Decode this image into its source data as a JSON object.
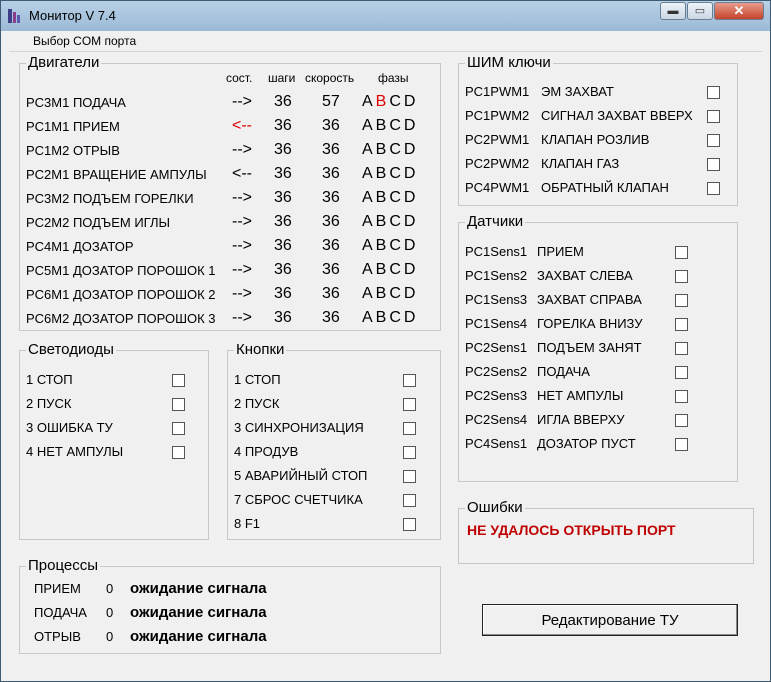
{
  "window": {
    "title": "Монитор  V 7.4",
    "min_glyph": "▬",
    "max_glyph": "▭",
    "close_glyph": "✕"
  },
  "menu": {
    "com_port": "Выбор COM порта"
  },
  "colors": {
    "error_red": "#c00000",
    "arrow_red": "#e00000"
  },
  "motors": {
    "title": "Двигатели",
    "headers": {
      "state": "сост.",
      "steps": "шаги",
      "speed": "скорость",
      "phases": "фазы"
    },
    "rows": [
      {
        "name": "PC3M1 ПОДАЧА",
        "arrow": "-->",
        "steps": "36",
        "speed": "57",
        "phases": [
          "A",
          "B",
          "C",
          "D"
        ],
        "red_phase": 1,
        "red_arrow": false
      },
      {
        "name": "PC1M1 ПРИЕМ",
        "arrow": "<--",
        "steps": "36",
        "speed": "36",
        "phases": [
          "A",
          "B",
          "C",
          "D"
        ],
        "red_phase": -1,
        "red_arrow": true
      },
      {
        "name": "PC1M2 ОТРЫВ",
        "arrow": "-->",
        "steps": "36",
        "speed": "36",
        "phases": [
          "A",
          "B",
          "C",
          "D"
        ],
        "red_phase": -1,
        "red_arrow": false
      },
      {
        "name": "PC2M1 ВРАЩЕНИЕ АМПУЛЫ",
        "arrow": "<--",
        "steps": "36",
        "speed": "36",
        "phases": [
          "A",
          "B",
          "C",
          "D"
        ],
        "red_phase": -1,
        "red_arrow": false
      },
      {
        "name": "PC3M2 ПОДЪЕМ ГОРЕЛКИ",
        "arrow": "-->",
        "steps": "36",
        "speed": "36",
        "phases": [
          "A",
          "B",
          "C",
          "D"
        ],
        "red_phase": -1,
        "red_arrow": false
      },
      {
        "name": "PC2M2 ПОДЪЕМ ИГЛЫ",
        "arrow": "-->",
        "steps": "36",
        "speed": "36",
        "phases": [
          "A",
          "B",
          "C",
          "D"
        ],
        "red_phase": -1,
        "red_arrow": false
      },
      {
        "name": "PC4M1 ДОЗАТОР",
        "arrow": "-->",
        "steps": "36",
        "speed": "36",
        "phases": [
          "A",
          "B",
          "C",
          "D"
        ],
        "red_phase": -1,
        "red_arrow": false
      },
      {
        "name": "PC5M1 ДОЗАТОР ПОРОШОК 1",
        "arrow": "-->",
        "steps": "36",
        "speed": "36",
        "phases": [
          "A",
          "B",
          "C",
          "D"
        ],
        "red_phase": -1,
        "red_arrow": false
      },
      {
        "name": "PC6M1 ДОЗАТОР ПОРОШОК 2",
        "arrow": "-->",
        "steps": "36",
        "speed": "36",
        "phases": [
          "A",
          "B",
          "C",
          "D"
        ],
        "red_phase": -1,
        "red_arrow": false
      },
      {
        "name": "PC6M2 ДОЗАТОР ПОРОШОК 3",
        "arrow": "-->",
        "steps": "36",
        "speed": "36",
        "phases": [
          "A",
          "B",
          "C",
          "D"
        ],
        "red_phase": -1,
        "red_arrow": false
      }
    ]
  },
  "pwm": {
    "title": "ШИМ ключи",
    "rows": [
      {
        "code": "PC1PWM1",
        "name": "ЭМ ЗАХВАТ"
      },
      {
        "code": "PC1PWM2",
        "name": "СИГНАЛ ЗАХВАТ ВВЕРХ"
      },
      {
        "code": "PC2PWM1",
        "name": "КЛАПАН РОЗЛИВ"
      },
      {
        "code": "PC2PWM2",
        "name": "КЛАПАН ГАЗ"
      },
      {
        "code": "PC4PWM1",
        "name": "ОБРАТНЫЙ КЛАПАН"
      }
    ]
  },
  "sensors": {
    "title": "Датчики",
    "rows": [
      {
        "code": "PC1Sens1",
        "name": "ПРИЕМ"
      },
      {
        "code": "PC1Sens2",
        "name": "ЗАХВАТ СЛЕВА"
      },
      {
        "code": "PC1Sens3",
        "name": "ЗАХВАТ СПРАВА"
      },
      {
        "code": "PC1Sens4",
        "name": "ГОРЕЛКА ВНИЗУ"
      },
      {
        "code": "PC2Sens1",
        "name": "ПОДЪЕМ ЗАНЯТ"
      },
      {
        "code": "PC2Sens2",
        "name": "ПОДАЧА"
      },
      {
        "code": "PC2Sens3",
        "name": "НЕТ АМПУЛЫ"
      },
      {
        "code": "PC2Sens4",
        "name": "ИГЛА ВВЕРХУ"
      },
      {
        "code": "PC4Sens1",
        "name": "ДОЗАТОР ПУСТ"
      }
    ]
  },
  "leds": {
    "title": "Светодиоды",
    "rows": [
      "1 СТОП",
      "2 ПУСК",
      "3 ОШИБКА ТУ",
      "4 НЕТ АМПУЛЫ"
    ]
  },
  "buttons_panel": {
    "title": "Кнопки",
    "rows": [
      "1 СТОП",
      "2 ПУСК",
      "3 СИНХРОНИЗАЦИЯ",
      "4 ПРОДУВ",
      "5 АВАРИЙНЫЙ СТОП",
      "7 СБРОС СЧЕТЧИКА",
      "8   F1"
    ]
  },
  "errors": {
    "title": "Ошибки",
    "text": "НЕ УДАЛОСЬ ОТКРЫТЬ ПОРТ"
  },
  "processes": {
    "title": "Процессы",
    "rows": [
      {
        "name": "ПРИЕМ",
        "count": "0",
        "status": "ожидание сигнала"
      },
      {
        "name": "ПОДАЧА",
        "count": "0",
        "status": "ожидание сигнала"
      },
      {
        "name": "ОТРЫВ",
        "count": "0",
        "status": "ожидание сигнала"
      }
    ]
  },
  "edit_button": {
    "label": "Редактирование ТУ"
  }
}
